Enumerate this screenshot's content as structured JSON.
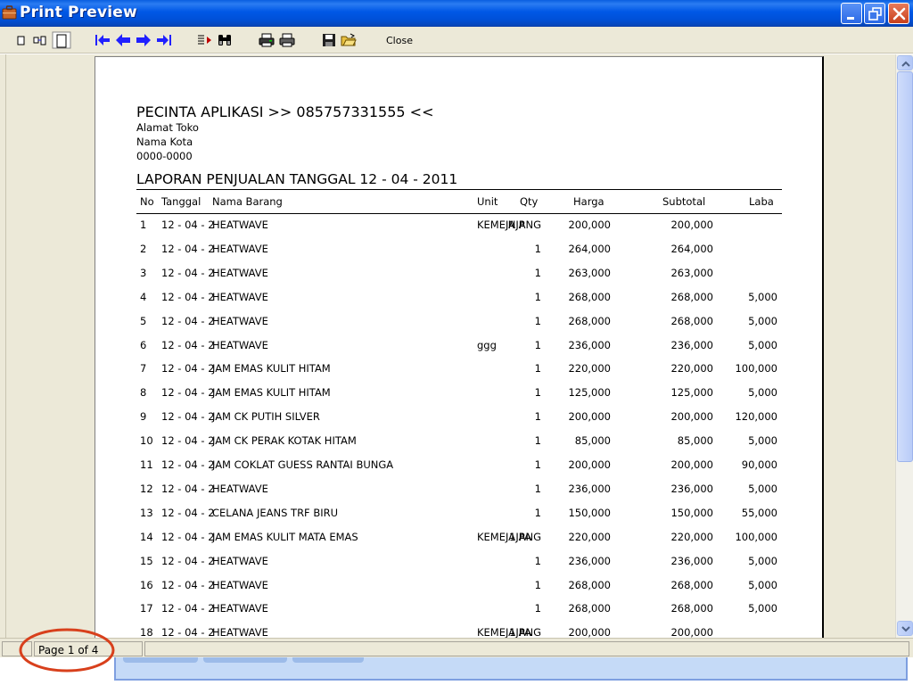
{
  "window": {
    "title": "Print Preview"
  },
  "toolbar": {
    "close_label": "Close",
    "icons": [
      "single-page-icon",
      "two-page-icon",
      "page-width-icon",
      "first-page-icon",
      "previous-page-icon",
      "next-page-icon",
      "last-page-icon",
      "goto-page-icon",
      "find-icon",
      "printer-setup-icon",
      "print-icon",
      "save-icon",
      "open-icon"
    ]
  },
  "report": {
    "store_name": "PECINTA APLIKASI >> 085757331555 <<",
    "address": "Alamat Toko",
    "city": "Nama Kota",
    "phone": "0000-0000",
    "subtitle": "LAPORAN PENJUALAN TANGGAL 12 - 04 - 2011",
    "columns": [
      "No",
      "Tanggal",
      "Nama Barang",
      "Unit",
      "Qty",
      "Harga",
      "Subtotal",
      "Laba"
    ],
    "rows": [
      {
        "no": "1",
        "tanggal": "12 - 04 - 2",
        "nama": "HEATWAVE",
        "unit": "KEMEJA P",
        "qty": " NJANG",
        "harga": "200,000",
        "subtotal": "200,000",
        "laba": ""
      },
      {
        "no": "2",
        "tanggal": "12 - 04 - 2",
        "nama": "HEATWAVE",
        "unit": "",
        "qty": "1",
        "harga": "264,000",
        "subtotal": "264,000",
        "laba": ""
      },
      {
        "no": "3",
        "tanggal": "12 - 04 - 2",
        "nama": "HEATWAVE",
        "unit": "",
        "qty": "1",
        "harga": "263,000",
        "subtotal": "263,000",
        "laba": ""
      },
      {
        "no": "4",
        "tanggal": "12 - 04 - 2",
        "nama": "HEATWAVE",
        "unit": "",
        "qty": "1",
        "harga": "268,000",
        "subtotal": "268,000",
        "laba": "5,000"
      },
      {
        "no": "5",
        "tanggal": "12 - 04 - 2",
        "nama": "HEATWAVE",
        "unit": "",
        "qty": "1",
        "harga": "268,000",
        "subtotal": "268,000",
        "laba": "5,000"
      },
      {
        "no": "6",
        "tanggal": "12 - 04 - 2",
        "nama": "HEATWAVE",
        "unit": "ggg",
        "qty": "1",
        "harga": "236,000",
        "subtotal": "236,000",
        "laba": "5,000"
      },
      {
        "no": "7",
        "tanggal": "12 - 04 - 2",
        "nama": "JAM EMAS KULIT HITAM",
        "unit": "",
        "qty": "1",
        "harga": "220,000",
        "subtotal": "220,000",
        "laba": "100,000"
      },
      {
        "no": "8",
        "tanggal": "12 - 04 - 2",
        "nama": "JAM EMAS KULIT HITAM",
        "unit": "",
        "qty": "1",
        "harga": "125,000",
        "subtotal": "125,000",
        "laba": "5,000"
      },
      {
        "no": "9",
        "tanggal": "12 - 04 - 2",
        "nama": "JAM CK PUTIH SILVER",
        "unit": "",
        "qty": "1",
        "harga": "200,000",
        "subtotal": "200,000",
        "laba": "120,000"
      },
      {
        "no": "10",
        "tanggal": "12 - 04 - 2",
        "nama": "JAM CK PERAK KOTAK HITAM",
        "unit": "",
        "qty": "1",
        "harga": "85,000",
        "subtotal": "85,000",
        "laba": "5,000"
      },
      {
        "no": "11",
        "tanggal": "12 - 04 - 2",
        "nama": "JAM COKLAT GUESS RANTAI BUNGA",
        "unit": "",
        "qty": "1",
        "harga": "200,000",
        "subtotal": "200,000",
        "laba": "90,000"
      },
      {
        "no": "12",
        "tanggal": "12 - 04 - 2",
        "nama": "HEATWAVE",
        "unit": "",
        "qty": "1",
        "harga": "236,000",
        "subtotal": "236,000",
        "laba": "5,000"
      },
      {
        "no": "13",
        "tanggal": "12 - 04 - 2",
        "nama": "CELANA JEANS TRF BIRU",
        "unit": "",
        "qty": "1",
        "harga": "150,000",
        "subtotal": "150,000",
        "laba": "55,000"
      },
      {
        "no": "14",
        "tanggal": "12 - 04 - 2",
        "nama": "JAM EMAS KULIT MATA EMAS",
        "unit": "KEMEJA PA",
        "qty": "1JANG",
        "harga": "220,000",
        "subtotal": "220,000",
        "laba": "100,000"
      },
      {
        "no": "15",
        "tanggal": "12 - 04 - 2",
        "nama": "HEATWAVE",
        "unit": "",
        "qty": "1",
        "harga": "236,000",
        "subtotal": "236,000",
        "laba": "5,000"
      },
      {
        "no": "16",
        "tanggal": "12 - 04 - 2",
        "nama": "HEATWAVE",
        "unit": "",
        "qty": "1",
        "harga": "268,000",
        "subtotal": "268,000",
        "laba": "5,000"
      },
      {
        "no": "17",
        "tanggal": "12 - 04 - 2",
        "nama": "HEATWAVE",
        "unit": "",
        "qty": "1",
        "harga": "268,000",
        "subtotal": "268,000",
        "laba": "5,000"
      },
      {
        "no": "18",
        "tanggal": "12 - 04 - 2",
        "nama": "HEATWAVE",
        "unit": "KEMEJA PA",
        "qty": "1JANG",
        "harga": "200,000",
        "subtotal": "200,000",
        "laba": ""
      }
    ]
  },
  "status": {
    "page_indicator": "Page 1 of 4"
  },
  "colors": {
    "titlebar": "#0054e3",
    "nav_arrows": "#2020ff",
    "highlight_ring": "#d8401c",
    "window_face": "#ece9d8"
  }
}
